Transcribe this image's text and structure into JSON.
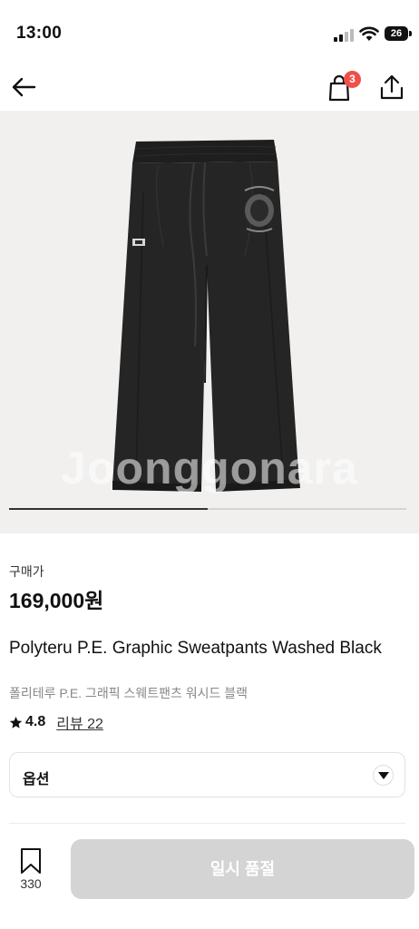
{
  "status_bar": {
    "time": "13:00",
    "battery": "26"
  },
  "header": {
    "cart_count": "3"
  },
  "gallery": {
    "watermark": "Joonggonara",
    "progress": 0.5
  },
  "product": {
    "price_label": "구매가",
    "price": "169,000원",
    "title_en": "Polyteru P.E. Graphic Sweatpants Washed Black",
    "title_ko": "폴리테루 P.E. 그래픽 스웨트팬츠 워시드 블랙",
    "rating": "4.8",
    "reviews": "리뷰 22"
  },
  "option": {
    "label": "옵션"
  },
  "footer": {
    "wishlist_count": "330",
    "buy_label": "일시 품절"
  },
  "colors": {
    "accent_badge": "#f0504a",
    "disabled_button": "#d4d4d4"
  },
  "icons": [
    "back-arrow-icon",
    "shopping-bag-icon",
    "share-icon",
    "star-icon",
    "chevron-down-icon",
    "bookmark-icon"
  ]
}
